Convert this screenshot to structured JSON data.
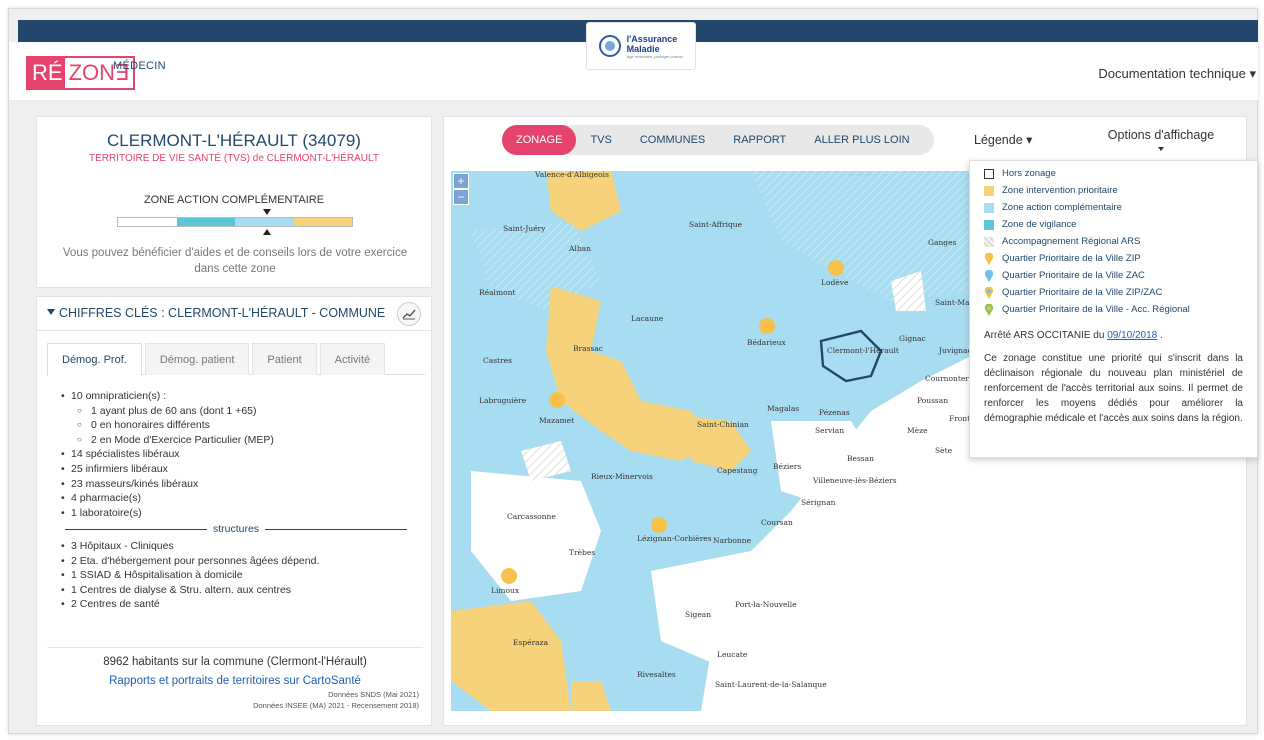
{
  "header": {
    "brand_part1": "RÉ",
    "brand_part2": "ZON∃",
    "section": "MÉDECIN",
    "partner_logo_line1": "l'Assurance",
    "partner_logo_line2": "Maladie",
    "partner_logo_tagline": "Agir ensemble, protéger chacun",
    "doc_menu": "Documentation technique ▾"
  },
  "commune": {
    "title": "CLERMONT-L'HÉRAULT (34079)",
    "tvs": "TERRITOIRE DE VIE SANTÉ (TVS) de CLERMONT-L'HÉRAULT",
    "zone_label": "ZONE ACTION COMPLÉMENTAIRE",
    "zone_scale_colors": [
      "#ffffff",
      "#5bc6d6",
      "#a8dcf0",
      "#f6d27a"
    ],
    "zone_description": "Vous pouvez bénéficier d'aides et de conseils lors de votre exercice dans cette zone"
  },
  "keyfigures": {
    "title": "CHIFFRES CLÉS : CLERMONT-L'HÉRAULT - COMMUNE",
    "chart_icon": "chart-icon",
    "tabs": [
      "Démog. Prof.",
      "Démog. patient",
      "Patient",
      "Activité"
    ],
    "omni": "10 omnipraticien(s) :",
    "omni_sub": [
      "1 ayant plus de 60 ans (dont 1 +65)",
      "0 en honoraires différents",
      "2 en Mode d'Exercice Particulier (MEP)"
    ],
    "professionals": [
      "14 spécialistes libéraux",
      "25 infirmiers libéraux",
      "23 masseurs/kinés libéraux",
      "4 pharmacie(s)",
      "1 laboratoire(s)"
    ],
    "structures_label": "structures",
    "structures": [
      "3 Hôpitaux - Cliniques",
      "2 Eta. d'hébergement pour personnes âgées dépend.",
      "1 SSIAD & Hôspitalisation à domicile",
      "1 Centres de dialyse & Stru. altern. aux centres",
      "2 Centres de santé"
    ],
    "habitants": "8962 habitants sur la commune (Clermont-l'Hérault)",
    "carto_link": "Rapports et portraits de territoires sur CartoSanté",
    "source1": "Données SNDS (Mai 2021)",
    "source2": "Données INSEE (MA) 2021 - Recensement 2018)"
  },
  "map": {
    "nav": [
      "ZONAGE",
      "TVS",
      "COMMUNES",
      "RAPPORT",
      "ALLER PLUS LOIN"
    ],
    "legend_toggle": "Légende ▾",
    "options_toggle": "Options d'affichage",
    "zoom_in": "+",
    "zoom_out": "−",
    "place_labels": [
      "Valence-d'Albigeois",
      "Saint-Juéry",
      "Alban",
      "Saint-Affrique",
      "Ganges",
      "Réalmont",
      "Lodève",
      "Lacaune",
      "Brassac",
      "Bédarieux",
      "Gignac",
      "Clermont-l'Hérault",
      "Castres",
      "Labruguière",
      "Mazamet",
      "Saint-Chinian",
      "Magalas",
      "Pézenas",
      "Servian",
      "Mèze",
      "Bessan",
      "Sète",
      "Rieux-Minervois",
      "Capestang",
      "Béziers",
      "Villeneuve-lès-Béziers",
      "Sérignan",
      "Carcassonne",
      "Coursan",
      "Trèbes",
      "Lézignan-Corbières",
      "Narbonne",
      "Limoux",
      "Port-la-Nouvelle",
      "Sigean",
      "Espéraza",
      "Leucate",
      "Rivesaltes",
      "Saint-Laurent-de-la-Salanque",
      "Saint-Mathieu-du-Fesc",
      "Juvignac",
      "Cournonterral",
      "Poussan",
      "Frontignan"
    ]
  },
  "legend": {
    "items": [
      {
        "label": "Hors zonage",
        "color": "#ffffff",
        "kind": "box"
      },
      {
        "label": "Zone intervention prioritaire",
        "color": "#f6d27a",
        "kind": "box"
      },
      {
        "label": "Zone action complémentaire",
        "color": "#a8dcf0",
        "kind": "box"
      },
      {
        "label": "Zone de vigilance",
        "color": "#5bc6d6",
        "kind": "box"
      },
      {
        "label": "Accompagnement Régional ARS",
        "color": "#e8e8e8",
        "kind": "hatch"
      },
      {
        "label": "Quartier Prioritaire de la Ville ZIP",
        "color": "#f6c04a",
        "kind": "pin"
      },
      {
        "label": "Quartier Prioritaire de la Ville ZAC",
        "color": "#6ec1ea",
        "kind": "pin"
      },
      {
        "label": "Quartier Prioritaire de la Ville ZIP/ZAC",
        "color": "#f6c04a",
        "kind": "pin2"
      },
      {
        "label": "Quartier Prioritaire de la Ville - Acc. Régional",
        "color": "#8fc45a",
        "kind": "pin3"
      }
    ],
    "arrete_prefix": "Arrêté ARS OCCITANIE du ",
    "arrete_date": "09/10/2018",
    "arrete_suffix": " .",
    "text": "Ce zonage constitue une priorité qui s'inscrit dans la déclinaison régionale du nouveau plan ministériel de renforcement de l'accès territorial aux soins. Il permet de renforcer les moyens dédiés pour améliorer la démographie médicale et l'accès aux soins dans la région."
  }
}
